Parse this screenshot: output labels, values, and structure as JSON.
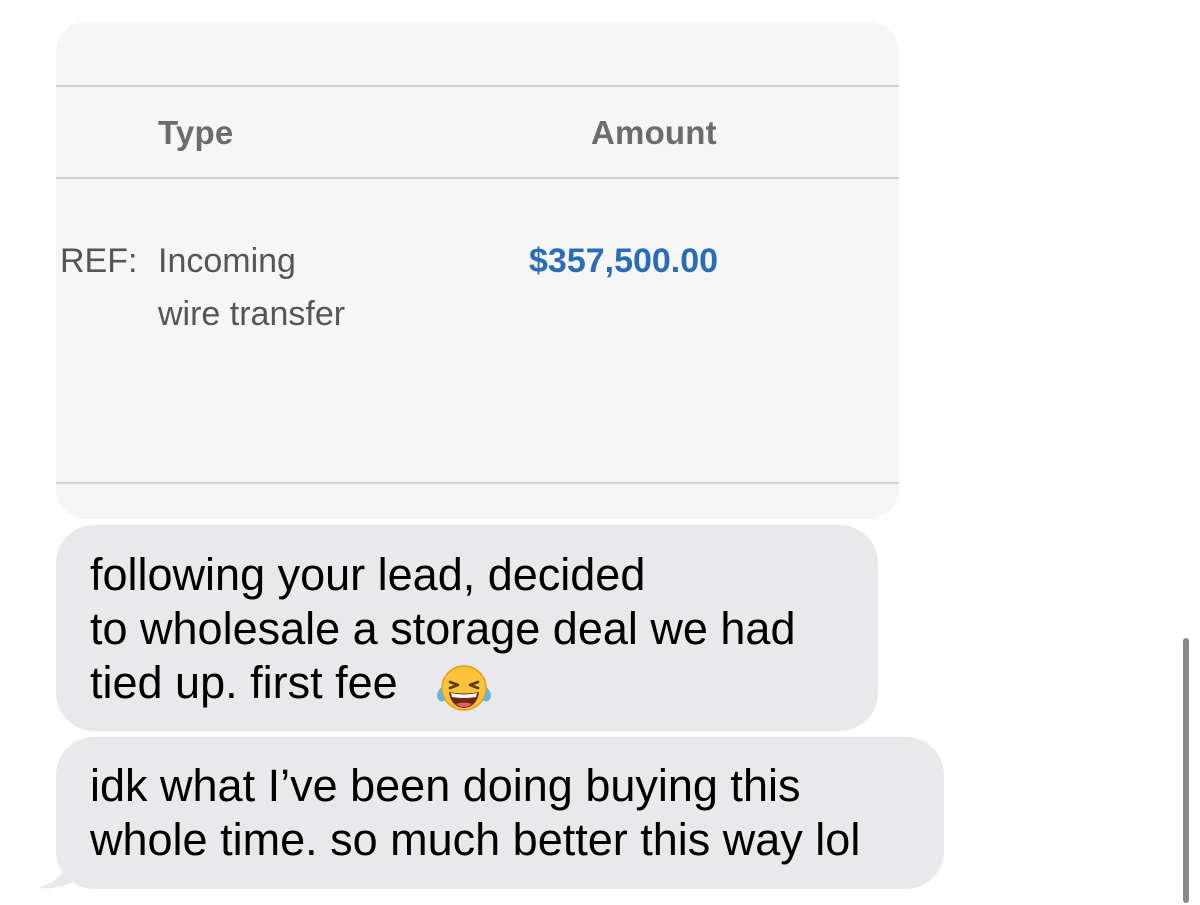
{
  "attachment": {
    "headers": {
      "type": "Type",
      "amount": "Amount"
    },
    "row": {
      "ref_label": "REF:",
      "type_lines": [
        "Incoming",
        "wire transfer"
      ],
      "amount": "$357,500.00"
    },
    "colors": {
      "amount": "#2a6db6",
      "card_bg": "#f6f6f6"
    }
  },
  "messages": [
    {
      "lines": [
        "following your lead, decided",
        "to wholesale a storage deal we had",
        "tied up. first fee"
      ],
      "emoji": "face-with-tears-of-joy-icon"
    },
    {
      "lines": [
        "idk what I’ve been doing buying this",
        "whole time. so much better this way lol"
      ]
    }
  ],
  "colors": {
    "bubble_bg": "#e9e9eb",
    "text": "#000000"
  }
}
